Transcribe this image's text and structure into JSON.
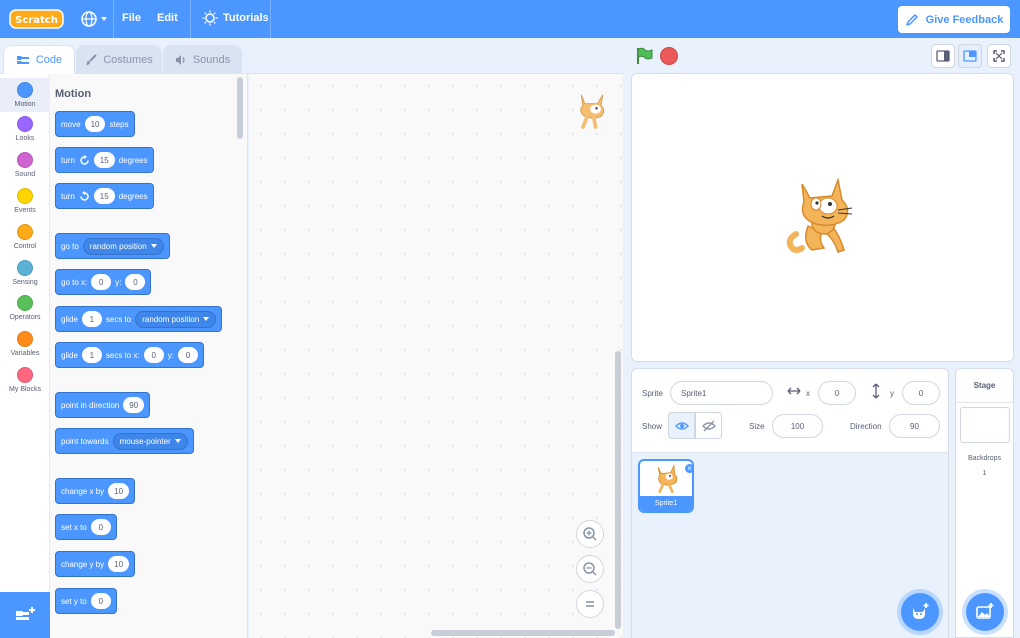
{
  "menubar": {
    "logo_text": "Scratch",
    "file": "File",
    "edit": "Edit",
    "tutorials": "Tutorials",
    "feedback": "Give Feedback"
  },
  "tabs": [
    {
      "label": "Code",
      "active": true
    },
    {
      "label": "Costumes",
      "active": false
    },
    {
      "label": "Sounds",
      "active": false
    }
  ],
  "categories": [
    {
      "label": "Motion",
      "color": "#4c97ff"
    },
    {
      "label": "Looks",
      "color": "#9966ff"
    },
    {
      "label": "Sound",
      "color": "#cf63cf"
    },
    {
      "label": "Events",
      "color": "#ffd500"
    },
    {
      "label": "Control",
      "color": "#ffab19"
    },
    {
      "label": "Sensing",
      "color": "#5cb1d6"
    },
    {
      "label": "Operators",
      "color": "#59c059"
    },
    {
      "label": "Variables",
      "color": "#ff8c1a"
    },
    {
      "label": "My Blocks",
      "color": "#ff6680"
    }
  ],
  "palette": {
    "title": "Motion",
    "blocks": {
      "move": {
        "a": "move",
        "v": "10",
        "b": "steps"
      },
      "turn_right": {
        "a": "turn",
        "v": "15",
        "b": "degrees"
      },
      "turn_left": {
        "a": "turn",
        "v": "15",
        "b": "degrees"
      },
      "go_to": {
        "a": "go to",
        "d": "random position"
      },
      "go_to_xy": {
        "a": "go to x:",
        "x": "0",
        "b": "y:",
        "y": "0"
      },
      "glide_to": {
        "a": "glide",
        "v": "1",
        "b": "secs to",
        "d": "random position"
      },
      "glide_xy": {
        "a": "glide",
        "v": "1",
        "b": "secs to x:",
        "x": "0",
        "c": "y:",
        "y": "0"
      },
      "point_dir": {
        "a": "point in direction",
        "v": "90"
      },
      "point_towards": {
        "a": "point towards",
        "d": "mouse-pointer"
      },
      "change_x": {
        "a": "change x by",
        "v": "10"
      },
      "set_x": {
        "a": "set x to",
        "v": "0"
      },
      "change_y": {
        "a": "change y by",
        "v": "10"
      },
      "set_y": {
        "a": "set y to",
        "v": "0"
      }
    }
  },
  "sprite_info": {
    "sprite_label": "Sprite",
    "sprite_name": "Sprite1",
    "x_label": "x",
    "x_value": "0",
    "y_label": "y",
    "y_value": "0",
    "show_label": "Show",
    "size_label": "Size",
    "size_value": "100",
    "direction_label": "Direction",
    "direction_value": "90"
  },
  "sprites": [
    {
      "name": "Sprite1",
      "selected": true
    }
  ],
  "stage_pane": {
    "title": "Stage",
    "backdrops_label": "Backdrops",
    "backdrops_count": "1"
  },
  "colors": {
    "accent": "#4c97ff",
    "stop": "#ec5959",
    "flag": "#4cbf56"
  }
}
